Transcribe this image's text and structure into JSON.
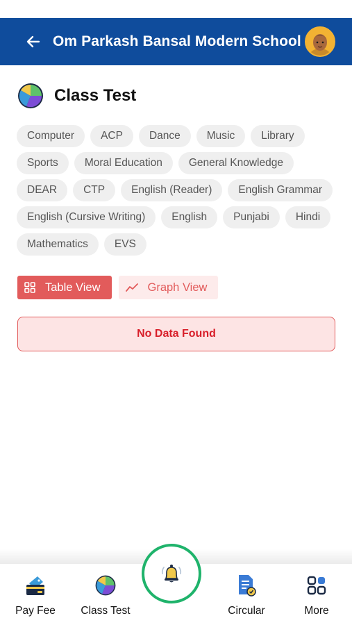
{
  "header": {
    "title": "Om Parkash Bansal Modern School",
    "back_icon": "arrow-left-icon",
    "avatar_icon": "student-avatar"
  },
  "page": {
    "title": "Class Test",
    "icon": "pie-chart-icon"
  },
  "subjects": [
    "Computer",
    "ACP",
    "Dance",
    "Music",
    "Library",
    "Sports",
    "Moral Education",
    "General Knowledge",
    "DEAR",
    "CTP",
    "English (Reader)",
    "English Grammar",
    "English (Cursive Writing)",
    "English",
    "Punjabi",
    "Hindi",
    "Mathematics",
    "EVS"
  ],
  "view_toggle": {
    "table_label": "Table View",
    "graph_label": "Graph View",
    "active": "table"
  },
  "empty_state": {
    "message": "No Data Found"
  },
  "bottom_nav": {
    "pay_fee": "Pay Fee",
    "class_test": "Class Test",
    "circular": "Circular",
    "more": "More",
    "center_icon": "bell-icon"
  },
  "colors": {
    "appbar": "#0f4c9c",
    "accent_red": "#e25b5b",
    "fab_ring": "#1fb36b"
  }
}
